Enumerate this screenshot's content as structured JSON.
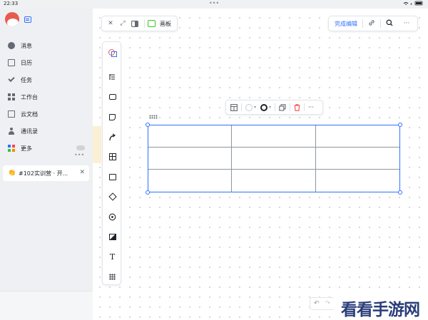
{
  "status_bar": {
    "time": "22:33",
    "top_dots": "•••"
  },
  "sidebar": {
    "items": [
      {
        "label": "消息",
        "icon": "message-icon"
      },
      {
        "label": "日历",
        "icon": "calendar-icon"
      },
      {
        "label": "任务",
        "icon": "task-check-icon"
      },
      {
        "label": "工作台",
        "icon": "workplace-icon"
      },
      {
        "label": "云文档",
        "icon": "cloud-doc-icon"
      },
      {
        "label": "通讯录",
        "icon": "contacts-icon"
      },
      {
        "label": "更多",
        "icon": "more-apps-icon"
      }
    ],
    "separator": "•••",
    "recent": {
      "label": "#102实训营 · 开...",
      "emoji": "👏",
      "close": "✕"
    }
  },
  "toolbar_left": {
    "close": "✕",
    "expand": "⤢",
    "board_label": "画板"
  },
  "toolbar_right": {
    "finish_label": "完成编辑",
    "link": "🔗",
    "search": "⌕",
    "more": "···"
  },
  "palette": {
    "items": [
      "shapes-icon",
      "mindmap-icon",
      "rectangle-icon",
      "sticky-note-icon",
      "connector-arrow-icon",
      "table-icon",
      "frame-icon",
      "eraser-icon",
      "stamp-icon",
      "image-icon",
      "text-icon",
      "more-grid-icon"
    ],
    "text_glyph": "T"
  },
  "table_toolbar": {
    "more": "···"
  },
  "table": {
    "rows": 3,
    "cols": 3
  },
  "undo_bar": {
    "undo": "↶",
    "redo": "↷"
  },
  "watermark": "看看手游网",
  "colors": {
    "accent": "#3370ff",
    "danger": "#f54a45",
    "board_green": "#34c724",
    "brand_red": "#e85a4f"
  }
}
